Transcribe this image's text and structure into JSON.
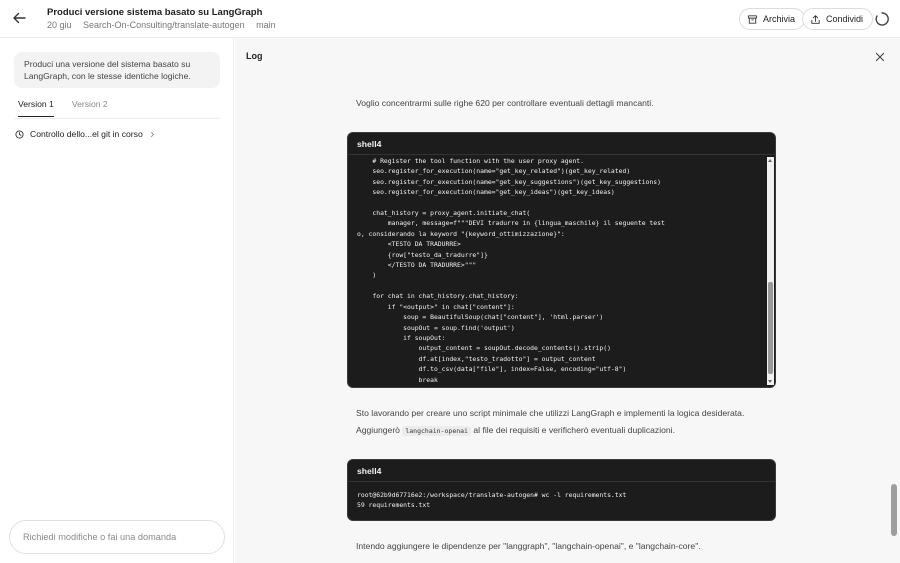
{
  "header": {
    "title": "Produci versione sistema basato su LangGraph",
    "date": "20 giu",
    "repo": "Search-On-Consulting/translate-autogen",
    "branch": "main",
    "archive_label": "Archivia",
    "share_label": "Condividi"
  },
  "left": {
    "prompt": "Produci una versione del sistema basato su LangGraph, con le stesse identiche logiche.",
    "tabs": [
      {
        "label": "Version 1",
        "active": true
      },
      {
        "label": "Version 2",
        "active": false
      }
    ],
    "task_status": "Controllo dello...el git in corso",
    "input_placeholder": "Richiedi modifiche o fai una domanda"
  },
  "log": {
    "label": "Log",
    "para1": "Voglio concentrarmi sulle righe 620 per controllare eventuali dettagli mancanti.",
    "shell1_title": "shell4",
    "shell1_code": "    # Register the tool function with the user proxy agent.\n    seo.register_for_execution(name=\"get_key_related\")(get_key_related)\n    seo.register_for_execution(name=\"get_key_suggestions\")(get_key_suggestions)\n    seo.register_for_execution(name=\"get_key_ideas\")(get_key_ideas)\n\n    chat_history = proxy_agent.initiate_chat(\n        manager, message=f\"\"\"DEVI tradurre in {lingua_maschile} il seguente test\no, considerando la keyword \"{keyword_ottimizzazione}\":\n        <TESTO DA TRADURRE>\n        {row[\"testo_da_tradurre\"]}\n        </TESTO DA TRADURRE>\"\"\"\n    )\n\n    for chat in chat_history.chat_history:\n        if \"<output>\" in chat[\"content\"]:\n            soup = BeautifulSoup(chat[\"content\"], 'html.parser')\n            soupOut = soup.find('output')\n            if soupOut:\n                output_content = soupOut.decode_contents().strip()\n                df.at[index,\"testo_tradotto\"] = output_content\n                df.to_csv(data[\"file\"], index=False, encoding=\"utf-8\")\n                break",
    "para2": "Sto lavorando per creare uno script minimale che utilizzi LangGraph e implementi la logica desiderata.",
    "para3_pre": "Aggiungerò",
    "para3_code": "langchain-openai",
    "para3_post": "al file dei requisiti e verificherò eventuali duplicazioni.",
    "shell2_title": "shell4",
    "shell2_code": "root@62b9d67716e2:/workspace/translate-autogen# wc -l requirements.txt\n59 requirements.txt",
    "para4": "Intendo aggiungere le dipendenze per \"langgraph\", \"langchain-openai\", e \"langchain-core\"."
  }
}
